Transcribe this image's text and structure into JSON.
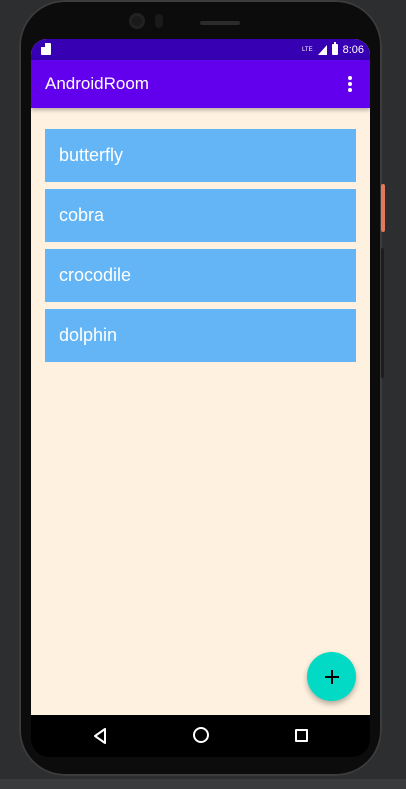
{
  "status_bar": {
    "network_label": "LTE",
    "time": "8:06"
  },
  "app_bar": {
    "title": "AndroidRoom",
    "overflow_icon": "more-vert-icon"
  },
  "list": {
    "items": [
      {
        "label": "butterfly"
      },
      {
        "label": "cobra"
      },
      {
        "label": "crocodile"
      },
      {
        "label": "dolphin"
      }
    ]
  },
  "fab": {
    "icon": "add-icon"
  },
  "nav_bar": {
    "back_icon": "back-icon",
    "home_icon": "home-icon",
    "recents_icon": "recents-icon"
  },
  "colors": {
    "status_bar": "#3700b3",
    "app_bar": "#6200ee",
    "list_item": "#64b5f6",
    "screen_bg": "#fff1df",
    "fab": "#03dac5"
  }
}
